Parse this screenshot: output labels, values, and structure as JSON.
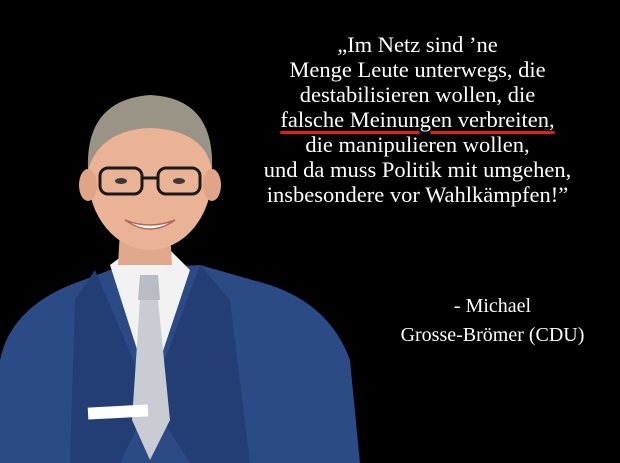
{
  "quote": {
    "line_1": "„Im Netz sind ’ne",
    "line_2": "Menge Leute unterwegs, die",
    "line_3": "destabilisieren wollen, die",
    "line_4": "falsche Meinungen verbreiten,",
    "line_5": "die manipulieren wollen,",
    "line_6": "und da muss Politik mit umgehen,",
    "line_7": "insbesondere vor Wahlkämpfen!”",
    "underline_color": "#e02020"
  },
  "attribution": {
    "line_1": "- Michael",
    "line_2": "Grosse-Brömer (CDU)"
  },
  "colors": {
    "background": "#000000",
    "text": "#ffffff",
    "suit": "#2b4a86",
    "tie": "#c9ccd3"
  },
  "image": {
    "subject": "portrait-photo"
  }
}
